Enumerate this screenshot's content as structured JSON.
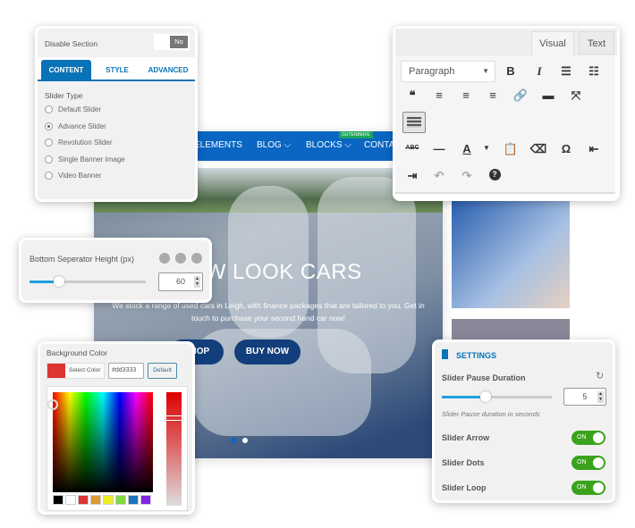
{
  "site": {
    "nav": [
      "ELEMENTS",
      "BLOG",
      "BLOCKS",
      "CONTACT"
    ],
    "badge": "GUTENBERG",
    "hero_title": "NEW LOOK CARS",
    "hero_sub": "We stock a range of used cars in Leigh, with finance packages that are tailored to you. Get in touch to purchase your second hand car now!",
    "btn_shop": "SHOP",
    "btn_buy": "BUY NOW"
  },
  "section_panel": {
    "disable_label": "Disable Section",
    "disable_value": "No",
    "tabs": [
      "CONTENT",
      "STYLE",
      "ADVANCED"
    ],
    "active_tab": "CONTENT",
    "slider_type_label": "Slider Type",
    "options": [
      "Default Slider",
      "Advance Slider",
      "Revolution Slider",
      "Single Banner Image",
      "Video Banner"
    ],
    "selected": "Advance Slider"
  },
  "editor": {
    "tabs": [
      "Visual",
      "Text"
    ],
    "active_tab": "Visual",
    "format": "Paragraph"
  },
  "separator_panel": {
    "label": "Bottom Seperator Height (px)",
    "value": "60",
    "slider_percent": 25
  },
  "color_panel": {
    "label": "Background Color",
    "select_label": "Select Color",
    "hex": "#dd3333",
    "default_label": "Default",
    "swatches": [
      "#000000",
      "#ffffff",
      "#dd3333",
      "#dd9933",
      "#eeee22",
      "#81d742",
      "#1e73be",
      "#8224e3"
    ],
    "accent": "#dd3333"
  },
  "settings_panel": {
    "title": "SETTINGS",
    "pause_label": "Slider Pause Duration",
    "pause_value": "5",
    "pause_help": "Slider Pause duration in seconds",
    "slider_percent": 40,
    "toggles": [
      {
        "label": "Slider Arrow",
        "state": "ON"
      },
      {
        "label": "Slider Dots",
        "state": "ON"
      },
      {
        "label": "Slider Loop",
        "state": "ON"
      }
    ],
    "accent": "#0a73b7",
    "on_color": "#3aa31b"
  }
}
